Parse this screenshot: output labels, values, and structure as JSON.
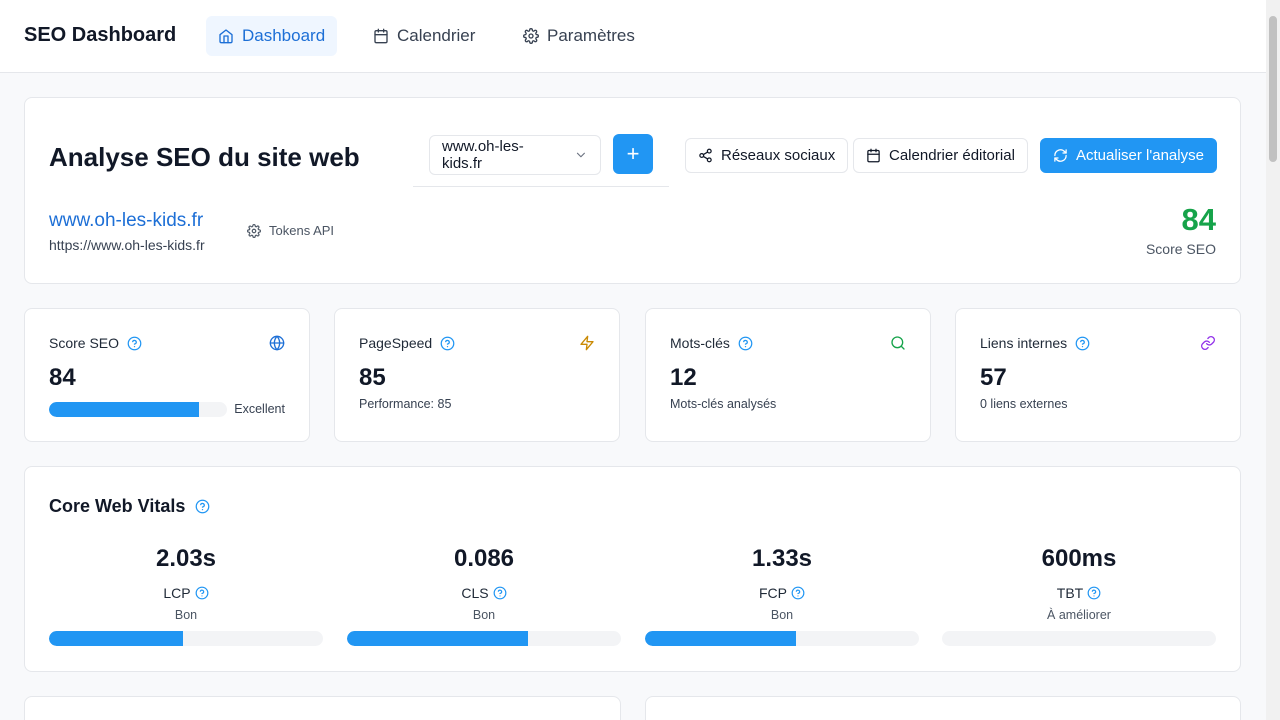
{
  "app": {
    "title": "SEO Dashboard"
  },
  "nav": [
    {
      "label": "Dashboard",
      "icon": "home-icon",
      "active": true
    },
    {
      "label": "Calendrier",
      "icon": "calendar-icon",
      "active": false
    },
    {
      "label": "Paramètres",
      "icon": "gear-icon",
      "active": false
    }
  ],
  "header": {
    "title": "Analyse SEO du site web",
    "site_select": "www.oh-les-kids.fr",
    "add_label": "+",
    "social_label": "Réseaux sociaux",
    "calendar_label": "Calendrier éditorial",
    "refresh_label": "Actualiser l'analyse",
    "site_name": "www.oh-les-kids.fr",
    "site_url": "https://www.oh-les-kids.fr",
    "tokens_label": "Tokens API",
    "score": "84",
    "score_label": "Score SEO"
  },
  "stats": [
    {
      "title": "Score SEO",
      "value": "84",
      "bar_label": "Excellent",
      "progress": 0.84,
      "icon": "globe-icon"
    },
    {
      "title": "PageSpeed",
      "value": "85",
      "sub": "Performance: 85",
      "icon": "lightning-icon"
    },
    {
      "title": "Mots-clés",
      "value": "12",
      "sub": "Mots-clés analysés",
      "icon": "search-icon"
    },
    {
      "title": "Liens internes",
      "value": "57",
      "sub": "0 liens externes",
      "icon": "link-icon"
    }
  ],
  "cwv": {
    "title": "Core Web Vitals",
    "items": [
      {
        "value": "2.03s",
        "label": "LCP",
        "status": "Bon",
        "progress": 0.49
      },
      {
        "value": "0.086",
        "label": "CLS",
        "status": "Bon",
        "progress": 0.66
      },
      {
        "value": "1.33s",
        "label": "FCP",
        "status": "Bon",
        "progress": 0.55
      },
      {
        "value": "600ms",
        "label": "TBT",
        "status": "À améliorer",
        "progress": 0
      }
    ]
  },
  "colors": {
    "accent": "#2196f3",
    "link": "#1d6fd6",
    "good": "#16a34a"
  }
}
